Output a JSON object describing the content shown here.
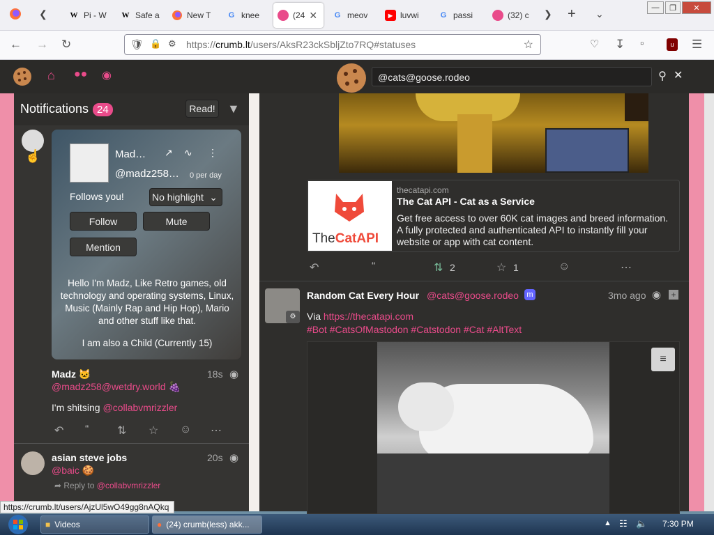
{
  "browser": {
    "tabs": [
      {
        "label": "Pi - W",
        "fav": "W"
      },
      {
        "label": "Safe a",
        "fav": "W"
      },
      {
        "label": "New T",
        "fav": "ff"
      },
      {
        "label": "knee",
        "fav": "G"
      },
      {
        "label": "(24",
        "fav": "c"
      },
      {
        "label": "meov",
        "fav": "G"
      },
      {
        "label": "luvwi",
        "fav": "yt"
      },
      {
        "label": "passi",
        "fav": "G"
      },
      {
        "label": "(32) c",
        "fav": "c"
      }
    ],
    "url_prefix": "https://",
    "url_host": "crumb.lt",
    "url_path": "/users/AksR23ckSbljZto7RQ#statuses",
    "status_url": "https://crumb.lt/users/AjzUl5wO49gg8nAQkq"
  },
  "app": {
    "search_value": "@cats@goose.rodeo"
  },
  "notifications": {
    "title": "Notifications",
    "count": "24",
    "read_label": "Read!"
  },
  "profile_card": {
    "name": "Mad…",
    "handle": "@madz258…",
    "rate": "0 per day",
    "follows_you": "Follows you!",
    "highlight": "No highlight",
    "follow": "Follow",
    "mute": "Mute",
    "mention": "Mention",
    "bio1": "Hello I'm Madz, Like Retro games, old technology and operating systems, Linux, Music (Mainly Rap and Hip Hop), Mario and other stuff like that.",
    "bio2": "I am also a Child (Currently 15)"
  },
  "post1": {
    "author": "Madz 🐱",
    "time": "18s",
    "handle": "@madz258@wetdry.world 🍇",
    "body_text": "I'm shitsing ",
    "body_mention": "@collabvmrizzler"
  },
  "post2": {
    "author": "asian steve jobs",
    "time": "20s",
    "handle": "@baic 🍪",
    "reply_label": "Reply to",
    "reply_mention": "@collabvmrizzler"
  },
  "link_card": {
    "logo_the": "The",
    "logo_cat": "CatAPI",
    "domain": "thecatapi.com",
    "title": "The Cat API - Cat as a Service",
    "desc": "Get free access to over 60K cat images and breed information. A fully protected and authenticated API to instantly fill your website or app with cat content."
  },
  "stats": {
    "boosts": "2",
    "favs": "1"
  },
  "feed_post": {
    "author": "Random Cat Every Hour",
    "handle": "@cats@goose.rodeo",
    "time": "3mo ago",
    "via": "Via ",
    "via_link": "https://thecatapi.com",
    "tags": "#Bot #CatsOfMastodon #Catstodon #Cat #AltText"
  },
  "taskbar": {
    "task1": "Videos",
    "task2": "(24) crumb(less) akk...",
    "clock": "7:30 PM"
  },
  "colors": {
    "accent": "#e94b8a",
    "boost": "#79bd9a"
  }
}
